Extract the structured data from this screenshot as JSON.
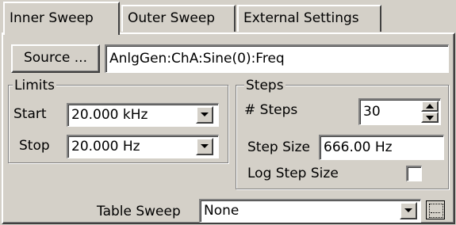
{
  "tabs": [
    {
      "label": "Inner Sweep",
      "active": true
    },
    {
      "label": "Outer Sweep",
      "active": false
    },
    {
      "label": "External Settings",
      "active": false
    }
  ],
  "source": {
    "button_label": "Source ...",
    "value": "AnlgGen:ChA:Sine(0):Freq"
  },
  "limits": {
    "legend": "Limits",
    "start_label": "Start",
    "start_value": "20.000 kHz",
    "stop_label": "Stop",
    "stop_value": "20.000 Hz"
  },
  "steps": {
    "legend": "Steps",
    "num_steps_label": "# Steps",
    "num_steps_value": "30",
    "step_size_label": "Step Size",
    "step_size_value": "666.00 Hz",
    "log_step_label": "Log Step Size",
    "log_step_checked": false
  },
  "table_sweep": {
    "label": "Table Sweep",
    "value": "None"
  },
  "icons": {
    "dropdown": "chevron-down-icon",
    "spin_up": "arrow-up-icon",
    "spin_down": "arrow-down-icon",
    "browse": "browse-icon"
  }
}
